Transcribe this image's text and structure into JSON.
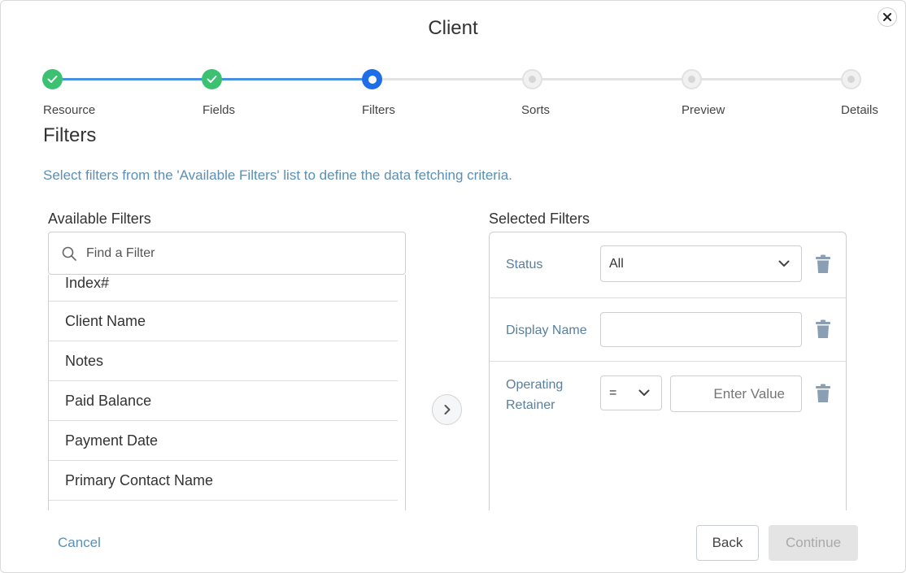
{
  "dialog": {
    "title": "Client"
  },
  "stepper": {
    "steps": [
      {
        "label": "Resource",
        "state": "done"
      },
      {
        "label": "Fields",
        "state": "done"
      },
      {
        "label": "Filters",
        "state": "active"
      },
      {
        "label": "Sorts",
        "state": "todo"
      },
      {
        "label": "Preview",
        "state": "todo"
      },
      {
        "label": "Details",
        "state": "todo"
      }
    ]
  },
  "page": {
    "section_title": "Filters",
    "hint": "Select filters from the 'Available Filters' list to define the data fetching criteria."
  },
  "available": {
    "label": "Available Filters",
    "search_placeholder": "Find a Filter",
    "items": [
      "Index#",
      "Client Name",
      "Notes",
      "Paid Balance",
      "Payment Date",
      "Primary Contact Name"
    ]
  },
  "selected": {
    "label": "Selected Filters",
    "rows": [
      {
        "label": "Status",
        "value": "All"
      },
      {
        "label": "Display Name",
        "value": ""
      },
      {
        "label_line1": "Operating",
        "label_line2": "Retainer",
        "operator": "=",
        "value_placeholder": "Enter Value"
      }
    ]
  },
  "footer": {
    "cancel": "Cancel",
    "back": "Back",
    "continue": "Continue"
  },
  "colors": {
    "done": "#3cc173",
    "active": "#1e6ee8",
    "link": "#5b8fb5",
    "trash": "#8a9fb4"
  },
  "icons": {
    "close": "close-icon",
    "check": "check-icon",
    "search": "search-icon",
    "chevron_right": "chevron-right-icon",
    "chevron_down": "chevron-down-icon",
    "trash": "trash-icon"
  }
}
